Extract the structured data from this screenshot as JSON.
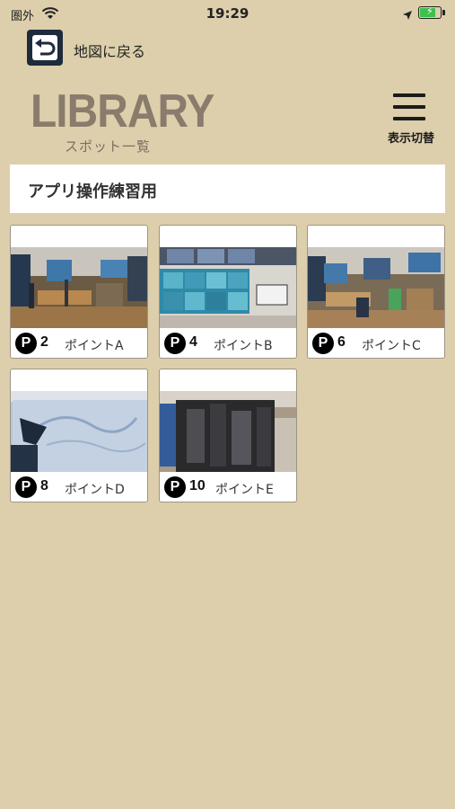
{
  "status": {
    "carrier": "圏外",
    "time": "19:29",
    "battery_level": 0.85,
    "battery_color": "#3cc14a"
  },
  "header": {
    "back_label": "地図に戻る",
    "logo_text": "LIBRARY",
    "logo_sub": "スポット一覧",
    "menu_label": "表示切替"
  },
  "category": {
    "title": "アプリ操作練習用"
  },
  "spots": [
    {
      "number": "2",
      "name": "ポイントA",
      "photo": "dive-shop-interior"
    },
    {
      "number": "4",
      "name": "ポイントB",
      "photo": "storefront-banner"
    },
    {
      "number": "6",
      "name": "ポイントC",
      "photo": "dive-shop-interior"
    },
    {
      "number": "8",
      "name": "ポイントD",
      "photo": "wall-map"
    },
    {
      "number": "10",
      "name": "ポイントE",
      "photo": "dive-gear-rack"
    }
  ],
  "colors": {
    "background": "#ddcfac",
    "back_button": "#1e2b3c",
    "logo": "#8a7c6c"
  }
}
